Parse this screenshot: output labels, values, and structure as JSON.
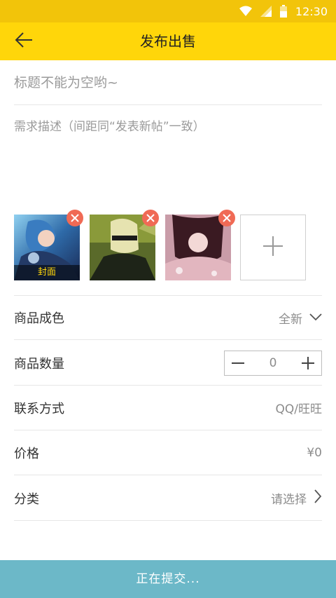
{
  "status_bar": {
    "time": "12:30"
  },
  "header": {
    "title": "发布出售",
    "back_icon": "arrow-left-icon"
  },
  "form": {
    "title_placeholder": "标题不能为空哟~",
    "description_placeholder": "需求描述（间距同“发表新帖”一致）",
    "photos": [
      {
        "name": "photo-1",
        "cover_label": "封面"
      },
      {
        "name": "photo-2"
      },
      {
        "name": "photo-3"
      }
    ],
    "rows": {
      "condition": {
        "label": "商品成色",
        "value": "全新"
      },
      "quantity": {
        "label": "商品数量",
        "value": "0"
      },
      "contact": {
        "label": "联系方式",
        "value": "QQ/旺旺"
      },
      "price": {
        "label": "价格",
        "value": "¥0"
      },
      "category": {
        "label": "分类",
        "value": "请选择"
      }
    }
  },
  "submit": {
    "label": "正在提交..."
  },
  "colors": {
    "header_bg": "#ffd60a",
    "status_bg": "#f2c40a",
    "submit_bg": "#6cb8c8",
    "remove_badge": "#f06a55"
  }
}
